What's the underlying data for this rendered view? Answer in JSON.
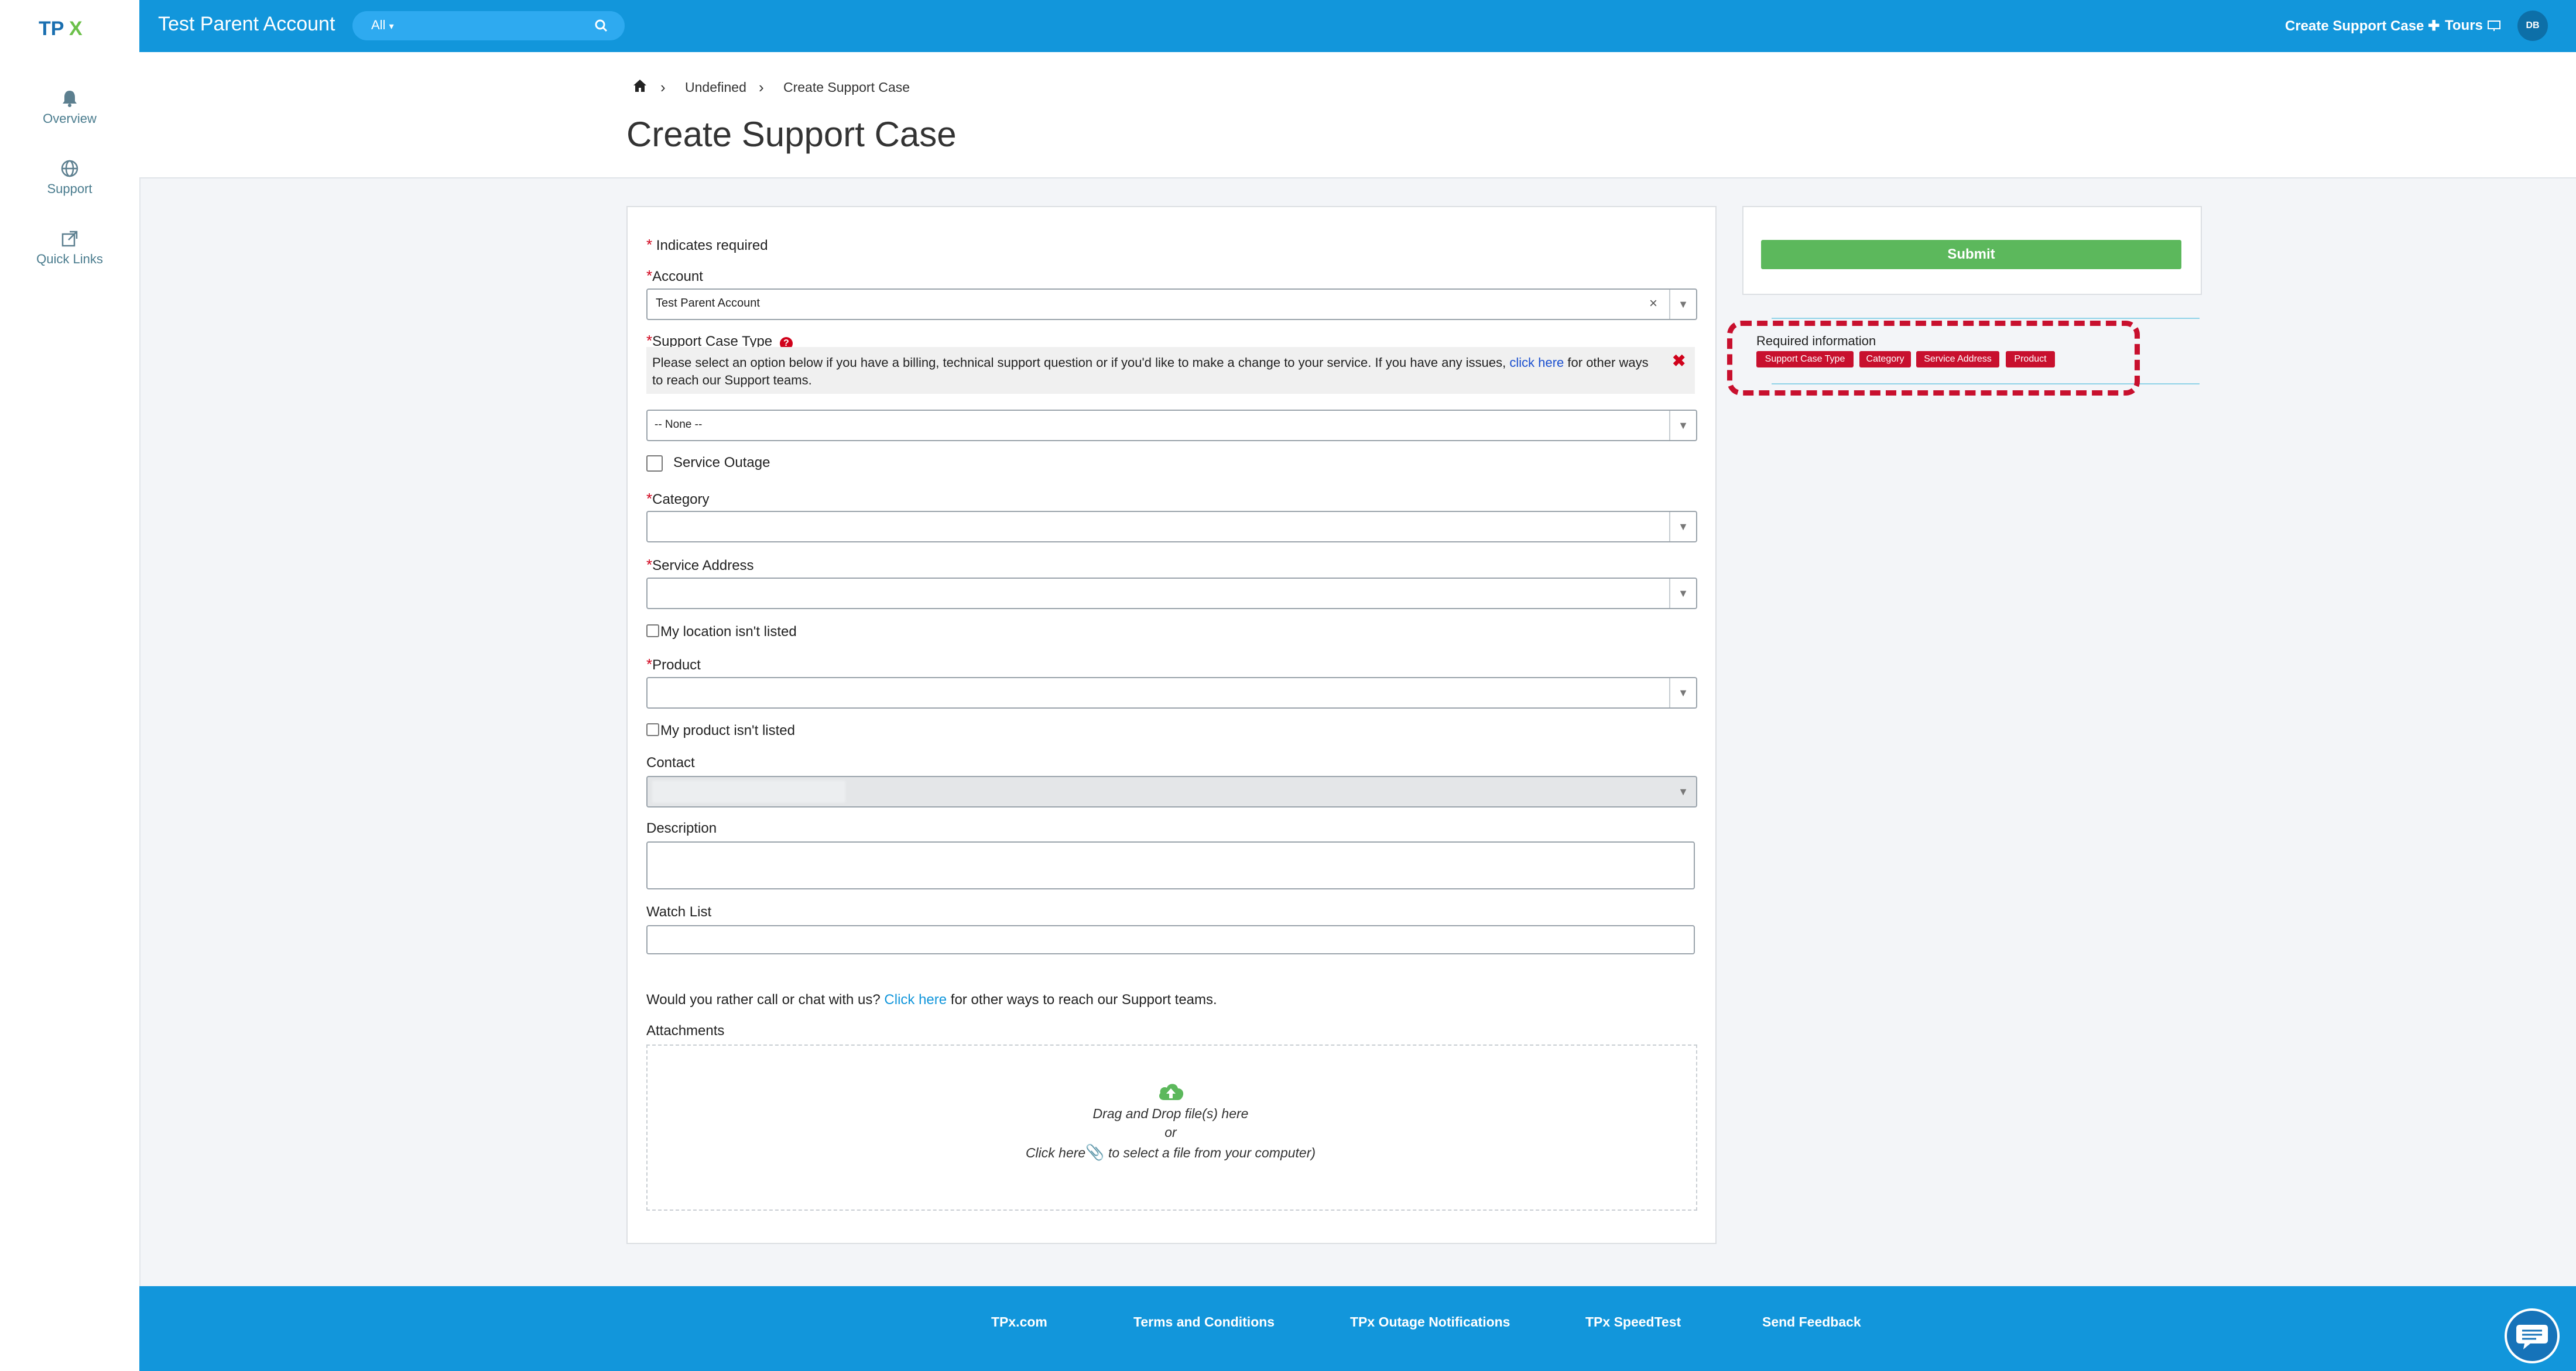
{
  "brand": {
    "logo_text": "TPX",
    "accent": "#1296db",
    "green": "#5cb85c",
    "red": "#c8102e"
  },
  "sidebar": {
    "items": [
      {
        "label": "Overview",
        "icon": "bell-icon"
      },
      {
        "label": "Support",
        "icon": "globe-icon"
      },
      {
        "label": "Quick Links",
        "icon": "external-link-icon"
      }
    ]
  },
  "topbar": {
    "account_title": "Test Parent Account",
    "search_scope": "All",
    "search_placeholder": "",
    "create_case": "Create Support Case",
    "tours": "Tours",
    "avatar_initials": "DB"
  },
  "breadcrumb": {
    "level1": "Undefined",
    "level2": "Create Support Case"
  },
  "page_title": "Create Support Case",
  "form": {
    "required_note": "Indicates required",
    "account_label": "Account",
    "account_value": "Test Parent Account",
    "case_type_label": "Support Case Type",
    "case_type_info_before": "Please select an option below if you have a billing, technical support question or if you'd like to make a change to your service. If you have any issues, ",
    "case_type_info_link": "click here",
    "case_type_info_after": " for other ways to reach our Support teams.",
    "case_type_value": "-- None --",
    "service_outage_label": "Service Outage",
    "category_label": "Category",
    "service_address_label": "Service Address",
    "location_not_listed": "My location isn't listed",
    "product_label": "Product",
    "product_not_listed": "My product isn't listed",
    "contact_label": "Contact",
    "description_label": "Description",
    "watch_list_label": "Watch List",
    "call_chat_before": "Would you rather call or chat with us? ",
    "call_chat_link": "Click here",
    "call_chat_after": " for other ways to reach our Support teams.",
    "attachments_label": "Attachments",
    "dropzone_line1": "Drag and Drop file(s) here",
    "dropzone_line2": "or",
    "dropzone_line3_before": "Click here",
    "dropzone_line3_after": " to select a file from your computer)"
  },
  "right_panel": {
    "submit_label": "Submit",
    "required_title": "Required information",
    "badges": [
      "Support Case Type",
      "Category",
      "Service Address",
      "Product"
    ]
  },
  "footer": {
    "links": [
      "TPx.com",
      "Terms and Conditions",
      "TPx Outage Notifications",
      "TPx SpeedTest",
      "Send Feedback"
    ]
  }
}
